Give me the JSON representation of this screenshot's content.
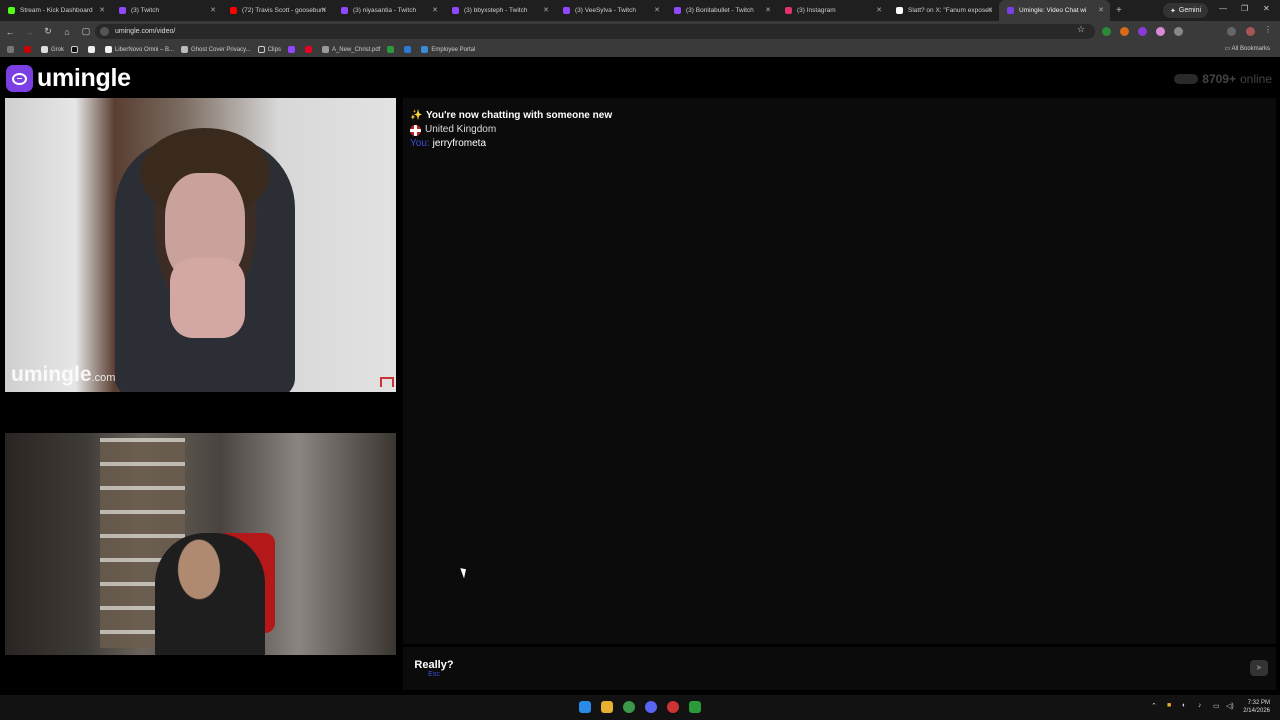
{
  "browser": {
    "tabs": [
      {
        "label": "Stream - Kick Dashboard",
        "color": "#53fc18"
      },
      {
        "label": "(3) Twitch",
        "color": "#9146ff"
      },
      {
        "label": "(72) Travis Scott - goosebum",
        "color": "#ff0000"
      },
      {
        "label": "(3) niyasantia - Twitch",
        "color": "#9146ff"
      },
      {
        "label": "(3) bbyxsteph - Twitch",
        "color": "#9146ff"
      },
      {
        "label": "(3) VeeSylva - Twitch",
        "color": "#9146ff"
      },
      {
        "label": "(3) Bonitabullet - Twitch",
        "color": "#9146ff"
      },
      {
        "label": "(3) Instagram",
        "color": "#e1306c"
      },
      {
        "label": "Slatt? on X: \"Fanum exposes",
        "color": "#ffffff"
      },
      {
        "label": "Umingle: Video Chat wi",
        "color": "#7b3fe4",
        "active": true
      }
    ],
    "gemini_label": "Gemini",
    "url": "umingle.com/video/",
    "bookmarks": [
      "Grok",
      "LiberNovo Omni – B...",
      "Ghost Cover Privacy...",
      "Clips",
      "A_New_Christ.pdf",
      "Employee Portal"
    ],
    "all_bookmarks_label": "All Bookmarks"
  },
  "site": {
    "logo_text": "umingle",
    "online_count": "8709+",
    "online_label": "online",
    "watermark_main": "umingle",
    "watermark_suffix": ".com",
    "chat": {
      "new_chat_msg": "You're now chatting with someone new",
      "country": "United Kingdom",
      "you_label": "You:",
      "username": "jerryfrometa"
    },
    "composer": {
      "really_label": "Really?",
      "esc_label": "Esc",
      "input_value": ""
    }
  },
  "taskbar": {
    "time": "7:32 PM",
    "date": "2/14/2026"
  }
}
